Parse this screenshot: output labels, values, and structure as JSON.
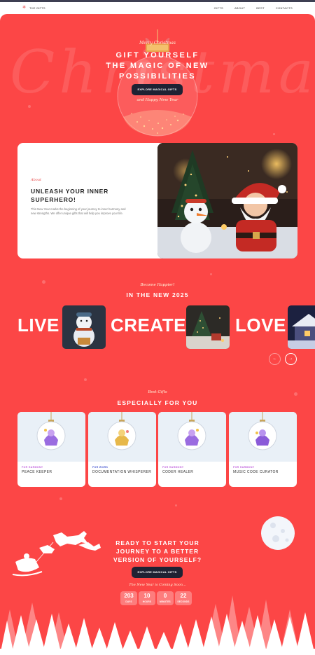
{
  "nav": {
    "logo_glyph": "❄",
    "brand": "THE GIFTS",
    "links": [
      "GIFTS",
      "ABOUT",
      "BEST",
      "CONTACTS"
    ]
  },
  "hero": {
    "background_word": "Christmas",
    "script_top": "Merry Christmas",
    "title_lines": [
      "GIFT YOURSELF",
      "THE MAGIC OF NEW",
      "POSSIBILITIES"
    ],
    "button": "EXPLORE MAGICAL GIFTS",
    "script_bottom": "and Happy New Year"
  },
  "about": {
    "kicker": "About",
    "heading": "UNLEASH YOUR INNER SUPERHERO!",
    "description": "This New Year marks the beginning of your journey to inner harmony and new strengths. We offer unique gifts that will help you improve your life."
  },
  "slider": {
    "script": "Become Happier!",
    "title": "IN THE NEW 2025",
    "words": [
      "LIVE",
      "CREATE",
      "LOVE"
    ],
    "prev_glyph": "←",
    "next_glyph": "→"
  },
  "gifts": {
    "script": "Best Gifts",
    "title": "ESPECIALLY FOR YOU",
    "cards": [
      {
        "tag": "FOR HARMONY",
        "name": "PEACE KEEPER"
      },
      {
        "tag": "FOR WORK",
        "name": "DOCUMENTATION WHISPERER"
      },
      {
        "tag": "FOR HARMONY",
        "name": "CODER HEALER"
      },
      {
        "tag": "FOR HARMONY",
        "name": "MUSIC CODE CURATOR"
      }
    ]
  },
  "cta": {
    "title_lines": [
      "READY TO START YOUR",
      "JOURNEY TO A BETTER",
      "VERSION OF YOURSELF?"
    ],
    "button": "EXPLORE MAGICAL GIFTS",
    "script": "The New Year is Coming Soon...",
    "countdown": [
      {
        "value": "203",
        "label": "DAYS"
      },
      {
        "value": "10",
        "label": "HOURS"
      },
      {
        "value": "0",
        "label": "MINUTES"
      },
      {
        "value": "22",
        "label": "SECONDS"
      }
    ]
  },
  "colors": {
    "page_red": "#fc4646",
    "dark_button": "#1f2233",
    "tag_harmony": "#c060dc",
    "tag_work": "#4b5bd1"
  }
}
